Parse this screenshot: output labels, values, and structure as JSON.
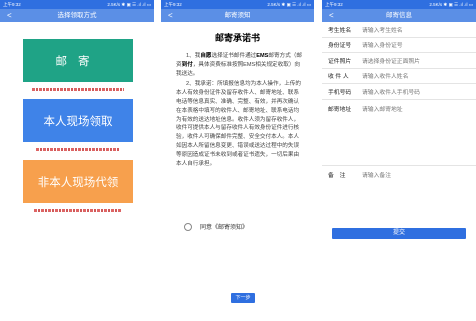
{
  "status_bar": {
    "left": "上午9:32",
    "right": "2.5K/s ✱ ▣ ☰ .ıl .ıl ▭"
  },
  "screen1": {
    "title": "选择领取方式",
    "back": "<",
    "options": {
      "mail": "邮寄",
      "self": "本人现场领取",
      "other": "非本人现场代领"
    }
  },
  "screen2": {
    "title": "邮寄须知",
    "back": "<",
    "heading": "邮寄承诺书",
    "p1_a": "1、我",
    "p1_b": "自愿",
    "p1_c": "选择证书邮件通过",
    "p1_d": "EMS",
    "p1_e": "邮寄方式（邮资",
    "p1_f": "到付",
    "p1_g": "，具体资费标准按照EMS相关规定收取）向我送达。",
    "p2": "2、我承诺：所填报信息均为本人操作，上传的本人有效身份证件及留存收件人、邮寄地址、联系电话等信息真实、准确、完整、有效，并再次确认在本表格中填写的收件人、邮寄地址、联系电话均为有效的送达地址信息。收件人须为留存收件人，收件可提供本人与留存收件人有效身份证件进行核验，收件人可确保邮件完整、安全交付本人。本人如因本人所留信息变更、错误或送达过程中的失误等原因造成证书未收到或者证书遗失，一切后果由本人自行承担。",
    "agree": "同意《邮寄须知》",
    "next": "下一步"
  },
  "screen3": {
    "title": "邮寄信息",
    "back": "<",
    "fields": [
      {
        "label": "考生姓名",
        "placeholder": "请输入考生姓名"
      },
      {
        "label": "身份证号",
        "placeholder": "请输入身份证号"
      },
      {
        "label": "证件照片",
        "placeholder": "请选择身份证正面照片"
      },
      {
        "label": "收 件 人",
        "placeholder": "请输入收件人姓名"
      },
      {
        "label": "手机号码",
        "placeholder": "请输入收件人手机号码"
      },
      {
        "label": "邮寄地址",
        "placeholder": "请输入邮寄地址"
      }
    ],
    "remark": {
      "label": "备　注",
      "placeholder": "请输入备注"
    },
    "submit": "提交"
  },
  "colors": {
    "status_blue": "#2f6fe0",
    "nav_blue": "#5b8fe6",
    "green": "#1fa386",
    "blue": "#3f83e8",
    "orange": "#f7a04d"
  }
}
